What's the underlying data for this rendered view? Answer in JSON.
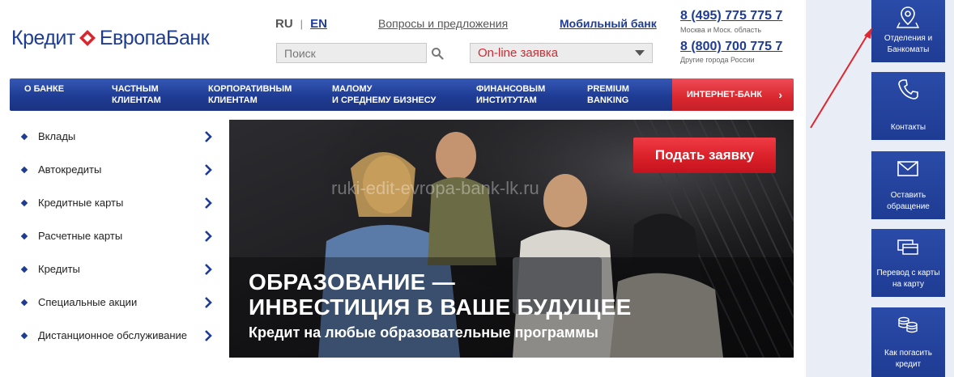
{
  "header": {
    "logo_left": "Кредит",
    "logo_right": "ЕвропаБанк",
    "lang_ru": "RU",
    "lang_sep": "|",
    "lang_en": "EN",
    "link_questions": "Вопросы и предложения",
    "link_mobile": "Мобильный банк",
    "search_placeholder": "Поиск",
    "online_request": "On-line заявка",
    "phone_1": "8 (495) 775 775 7",
    "phone_1_note": "Москва и Моск. область",
    "phone_2": "8 (800) 700 775 7",
    "phone_2_note": "Другие города России"
  },
  "nav": {
    "items": [
      {
        "line1": "О банке",
        "line2": ""
      },
      {
        "line1": "Частным",
        "line2": "клиентам"
      },
      {
        "line1": "Корпоративным",
        "line2": "клиентам"
      },
      {
        "line1": "Малому",
        "line2": "и среднему бизнесу"
      },
      {
        "line1": "Финансовым",
        "line2": "институтам"
      },
      {
        "line1": "Premium",
        "line2": "banking"
      }
    ],
    "internet_bank": "Интернет-банк",
    "internet_arrow": "›"
  },
  "side_menu": {
    "items": [
      "Вклады",
      "Автокредиты",
      "Кредитные карты",
      "Расчетные карты",
      "Кредиты",
      "Специальные акции",
      "Дистанционное обслуживание"
    ]
  },
  "banner": {
    "button": "Подать заявку",
    "headline_1": "ОБРАЗОВАНИЕ —",
    "headline_2": "ИНВЕСТИЦИЯ В ВАШЕ БУДУЩЕЕ",
    "subtitle": "Кредит на любые образовательные программы",
    "watermark": "ruki-edit-evropa-bank-lk.ru"
  },
  "right_panel": {
    "tiles": [
      {
        "label": "Отделения и Банкоматы",
        "icon": "map-pin-icon"
      },
      {
        "label": "Контакты",
        "icon": "phone-icon"
      },
      {
        "label": "Оставить обращение",
        "icon": "envelope-icon"
      },
      {
        "label": "Перевод с карты на карту",
        "icon": "card-transfer-icon"
      },
      {
        "label": "Как погасить кредит",
        "icon": "coins-icon"
      }
    ]
  },
  "colors": {
    "brand_blue": "#1f3c94",
    "brand_red": "#d9272e",
    "panel_bg": "#e9eef6"
  }
}
